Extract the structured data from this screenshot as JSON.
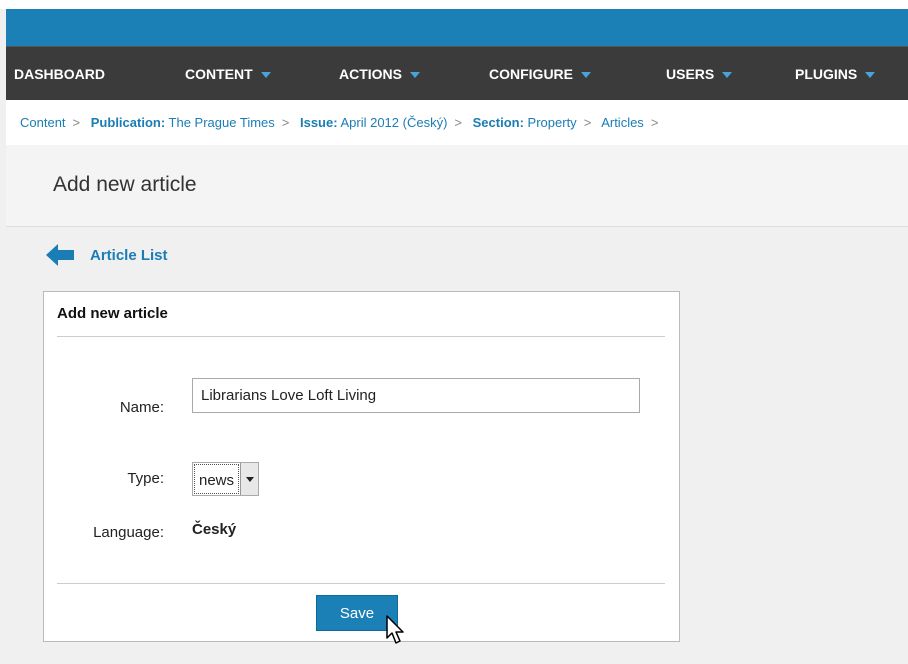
{
  "nav": {
    "dashboard": "DASHBOARD",
    "content": "CONTENT",
    "actions": "ACTIONS",
    "configure": "CONFIGURE",
    "users": "USERS",
    "plugins": "PLUGINS"
  },
  "breadcrumb": {
    "content": "Content",
    "publication_label": "Publication:",
    "publication_value": "The Prague Times",
    "issue_label": "Issue:",
    "issue_value": "April 2012 (Český)",
    "section_label": "Section:",
    "section_value": "Property",
    "articles": "Articles",
    "separator": ">"
  },
  "page": {
    "title": "Add new article",
    "back_link": "Article List"
  },
  "form": {
    "panel_title": "Add new article",
    "name_label": "Name:",
    "name_value": "Librarians Love Loft Living",
    "type_label": "Type:",
    "type_value": "news",
    "language_label": "Language:",
    "language_value": "Český",
    "save_label": "Save"
  },
  "colors": {
    "accent": "#1a80b6",
    "nav_bg": "#3b3b3b",
    "link": "#1a7db5"
  }
}
